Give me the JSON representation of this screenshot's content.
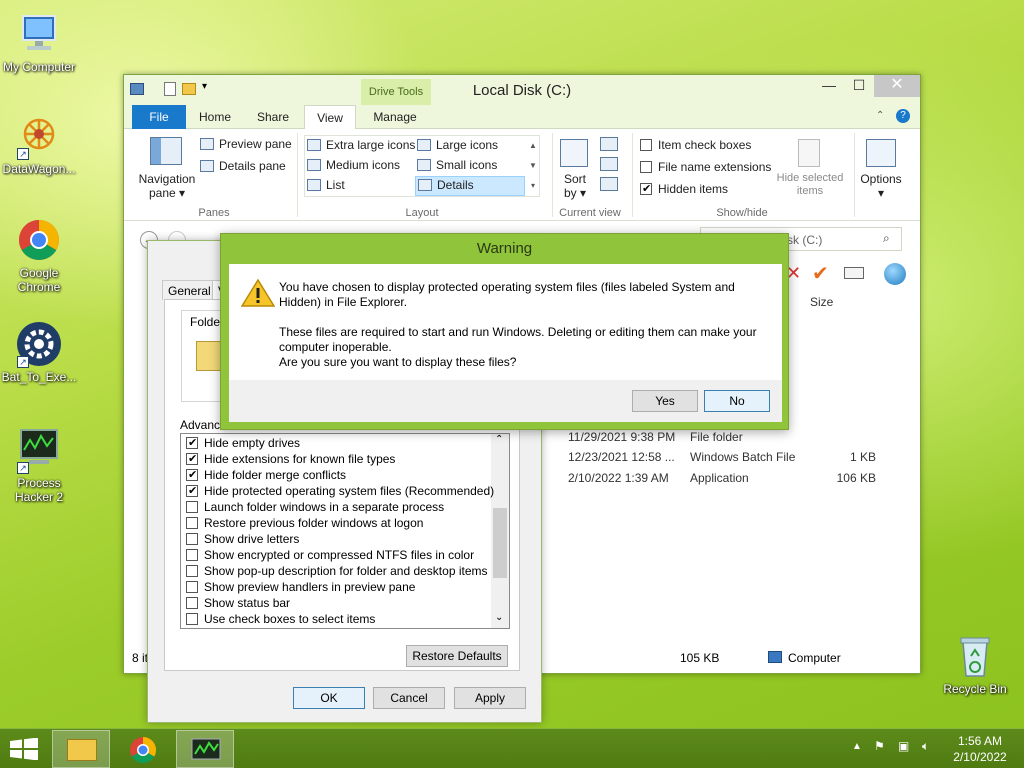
{
  "desktop": {
    "icons": [
      {
        "label": "My Computer",
        "icon": "computer-icon"
      },
      {
        "label": "DataWagon...",
        "icon": "datawagon-icon"
      },
      {
        "label": "Google Chrome",
        "icon": "chrome-icon"
      },
      {
        "label": "Bat_To_Exe...",
        "icon": "gear-icon"
      },
      {
        "label": "Process Hacker 2",
        "icon": "process-hacker-icon"
      },
      {
        "label": "Recycle Bin",
        "icon": "recycle-bin-icon"
      }
    ]
  },
  "explorer": {
    "title": "Local Disk (C:)",
    "context_tab": "Drive Tools",
    "tabs": [
      "File",
      "Home",
      "Share",
      "View",
      "Manage"
    ],
    "active_tab": "View",
    "ribbon": {
      "panes": {
        "navigation": "Navigation pane",
        "preview": "Preview pane",
        "details": "Details pane",
        "group": "Panes"
      },
      "layout": {
        "items": [
          "Extra large icons",
          "Large icons",
          "Medium icons",
          "Small icons",
          "List",
          "Details"
        ],
        "selected": "Details",
        "group": "Layout"
      },
      "current_view": {
        "sort": "Sort by",
        "group": "Current view"
      },
      "show_hide": {
        "item_check_boxes": "Item check boxes",
        "file_name_extensions": "File name extensions",
        "hidden_items": "Hidden items",
        "hide_selected": "Hide selected items",
        "group": "Show/hide"
      },
      "options": "Options"
    },
    "search_placeholder_tail": "sk (C:)",
    "column_size": "Size",
    "rows": [
      {
        "date": "11/29/2021 9:38 PM",
        "type": "File folder",
        "size": ""
      },
      {
        "date": "12/23/2021 12:58 ...",
        "type": "Windows Batch File",
        "size": "1 KB"
      },
      {
        "date": "2/10/2022 1:39 AM",
        "type": "Application",
        "size": "106 KB"
      }
    ],
    "status_left": "8 it",
    "status_size": "105 KB",
    "status_location": "Computer"
  },
  "folder_options": {
    "tab_general": "General",
    "tab_view_partial": "V",
    "folder_views_partial": "Folder",
    "advanced_partial": "Advance",
    "advanced_items": [
      {
        "label": "Hide empty drives",
        "checked": true
      },
      {
        "label": "Hide extensions for known file types",
        "checked": true
      },
      {
        "label": "Hide folder merge conflicts",
        "checked": true
      },
      {
        "label": "Hide protected operating system files (Recommended)",
        "checked": true
      },
      {
        "label": "Launch folder windows in a separate process",
        "checked": false
      },
      {
        "label": "Restore previous folder windows at logon",
        "checked": false
      },
      {
        "label": "Show drive letters",
        "checked": false
      },
      {
        "label": "Show encrypted or compressed NTFS files in color",
        "checked": false
      },
      {
        "label": "Show pop-up description for folder and desktop items",
        "checked": false
      },
      {
        "label": "Show preview handlers in preview pane",
        "checked": false
      },
      {
        "label": "Show status bar",
        "checked": false
      },
      {
        "label": "Use check boxes to select items",
        "checked": false
      }
    ],
    "restore_defaults": "Restore Defaults",
    "ok": "OK",
    "cancel": "Cancel",
    "apply": "Apply"
  },
  "warning": {
    "title": "Warning",
    "line1": "You have chosen to display protected operating system files (files labeled System and Hidden) in File Explorer.",
    "line2": "These files are required to start and run Windows. Deleting or editing them can make your computer inoperable.",
    "line3": "Are you sure you want to display these files?",
    "yes": "Yes",
    "no": "No"
  },
  "taskbar": {
    "time": "1:56 AM",
    "date": "2/10/2022",
    "apps": [
      "file-explorer-icon",
      "chrome-icon",
      "process-hacker-icon"
    ]
  }
}
